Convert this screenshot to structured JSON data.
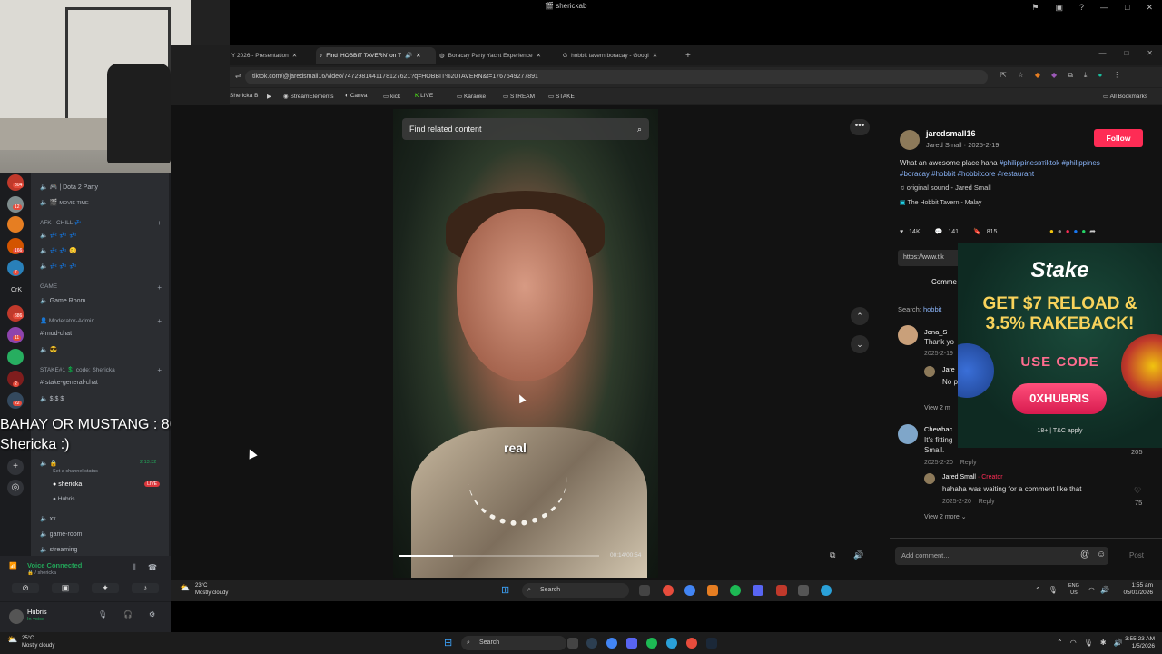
{
  "titlebar": {
    "title": "sherickab"
  },
  "overlay": {
    "line1": "BAHAY OR MUSTANG : 8620 SUBS",
    "line2": "Shericka :)"
  },
  "discord": {
    "server_badges": [
      "304",
      "12",
      "166",
      "7",
      "686",
      "11",
      "22",
      "2"
    ],
    "server_initials": "CrK",
    "categories": {
      "afk": "AFK | CHILL 💤",
      "game": "GAME",
      "moderator": "Moderator-Admin",
      "stake": "STAKE#1 💲 code: Shericka"
    },
    "channels": {
      "dota": "| Dota 2 Party",
      "movie": "MOVIE TIME",
      "game_room": "Game Room",
      "mod_chat": "mod-chat",
      "stake_chat": "stake-general-chat",
      "xx": "xx",
      "game_room2": "game-room",
      "streaming": "streaming"
    },
    "timer": "2:13:32",
    "status_placeholder": "Set a channel status",
    "voice_users": [
      {
        "name": "shericka",
        "badge": "LIVE"
      },
      {
        "name": "Hubris",
        "badge": ""
      }
    ],
    "voice_connected": "Voice Connected",
    "voice_channel": "/ shericka",
    "user": {
      "name": "Hubris",
      "status": "In voice"
    }
  },
  "browser": {
    "tabs": [
      {
        "label": "Y 2026 - Presentation"
      },
      {
        "label": "Find 'HOBBIT TAVERN' on T"
      },
      {
        "label": "Boracay Party Yacht Experience"
      },
      {
        "label": "hobbit tavern boracay - Googl"
      }
    ],
    "new_tab": "+",
    "url": "tiktok.com/@jaredsmall16/video/7472981441178127621?q=HOBBIT%20TAVERN&t=1767549277891",
    "bookmarks": [
      "Shericka B",
      "StreamElements",
      "Canva",
      "kick",
      "LIVE",
      "Karaoke",
      "STREAM",
      "STAKE"
    ],
    "all_bookmarks": "All Bookmarks"
  },
  "video": {
    "search_placeholder": "Find related content",
    "caption": "real",
    "time": "00:14/00:54",
    "progress_fraction": 0.27
  },
  "post": {
    "username": "jaredsmall16",
    "display": "Jared Small · 2025-2-19",
    "follow": "Follow",
    "description": "What an awesome place haha",
    "hashtags": "#philippinesвтiktok #philippines #boracay #hobbit #hobbitcore #restaurant",
    "sound": "original sound - Jared Small",
    "location": "The Hobbit Tavern - Malay",
    "likes": "14K",
    "comments": "141",
    "saves": "815",
    "link": "https://www.tik",
    "comments_tab": "Comme",
    "search_label": "Search:",
    "search_term": "hobbit",
    "comments_list": [
      {
        "user": "Jona_S",
        "text": "Thank yo",
        "date": "2025-2-19",
        "reply_user": "Jare",
        "reply_text": "No p",
        "view": "View 2 m"
      },
      {
        "user": "Chewbac",
        "text": "It's fitting",
        "text2": "Small.",
        "date": "2025-2-20",
        "reply": "Reply",
        "likes": "205"
      },
      {
        "user": "Jared Small",
        "tag": "· Creator",
        "text": "hahaha was waiting for a comment like that",
        "date": "2025-2-20",
        "reply": "Reply",
        "likes": "75"
      }
    ],
    "view_more": "View 2 more",
    "add_comment": "Add comment...",
    "post_btn": "Post"
  },
  "stake": {
    "logo": "Stake",
    "headline1": "GET $7 RELOAD &",
    "headline2": "3.5% RAKEBACK!",
    "use_code": "USE CODE",
    "code": "0XHUBRIS",
    "tc": "18+ | T&C apply"
  },
  "inner_taskbar": {
    "temp": "23°C",
    "weather": "Mostly cloudy",
    "search": "Search",
    "lang1": "ENG",
    "lang2": "US",
    "time": "1:55 am",
    "date": "05/01/2026"
  },
  "taskbar": {
    "temp": "25°C",
    "weather": "Mostly cloudy",
    "search": "Search",
    "time": "3:55:23 AM",
    "date": "1/5/2026"
  }
}
